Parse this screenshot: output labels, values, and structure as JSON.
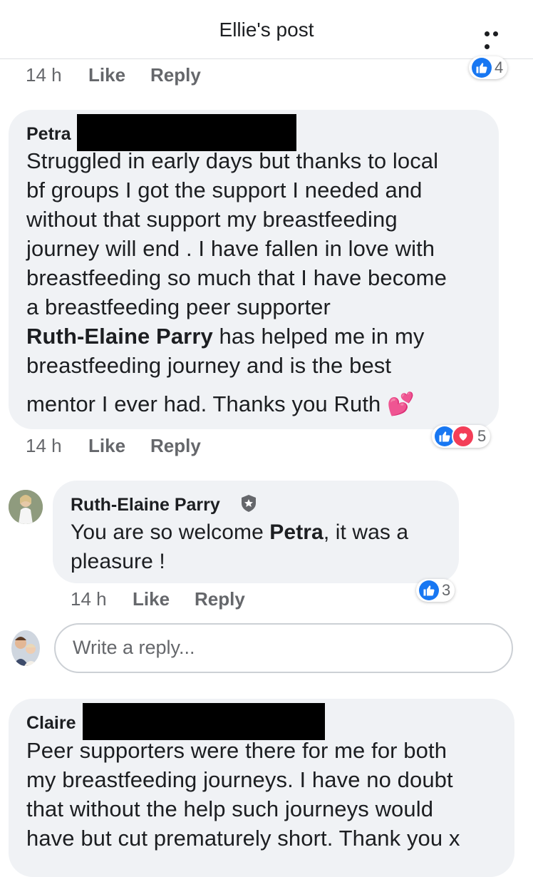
{
  "header": {
    "title": "Ellie's post",
    "more_icon": "more-horizontal-icon"
  },
  "top_meta": {
    "time": "14 h",
    "like": "Like",
    "reply": "Reply",
    "reaction_count": "4"
  },
  "comment_petra": {
    "author": "Petra",
    "lines": [
      "Struggled in early days but thanks to local",
      "bf groups I got the support I needed and",
      "without that support my breastfeeding",
      "journey will end . I have fallen in love with",
      "breastfeeding so much that I have become",
      "a breastfeeding peer supporter"
    ],
    "mention": "Ruth-Elaine Parry",
    "line7_rest": " has helped me in my",
    "line8": "breastfeeding journey and is the best",
    "line9": "mentor I ever had. Thanks you Ruth",
    "emoji": "💕",
    "time": "14 h",
    "like": "Like",
    "reply": "Reply",
    "reaction_count": "5"
  },
  "reply_ruth": {
    "author": "Ruth-Elaine Parry",
    "badge_icon": "moderator-shield-icon",
    "text_before": "You are so welcome ",
    "mention": "Petra",
    "text_after": ", it was a",
    "line2": "pleasure !",
    "time": "14 h",
    "like": "Like",
    "reply": "Reply",
    "reaction_count": "3"
  },
  "reply_input": {
    "placeholder": "Write a reply..."
  },
  "comment_claire": {
    "author": "Claire",
    "lines": [
      "Peer supporters were there for me for both",
      "my breastfeeding journeys. I have no doubt",
      "that without the help such journeys would",
      "have but cut prematurely short. Thank you x"
    ]
  },
  "colors": {
    "like_blue": "#1877f2",
    "love_red": "#f33e58",
    "bubble_gray": "#f0f2f5",
    "meta_gray": "#65676b"
  }
}
